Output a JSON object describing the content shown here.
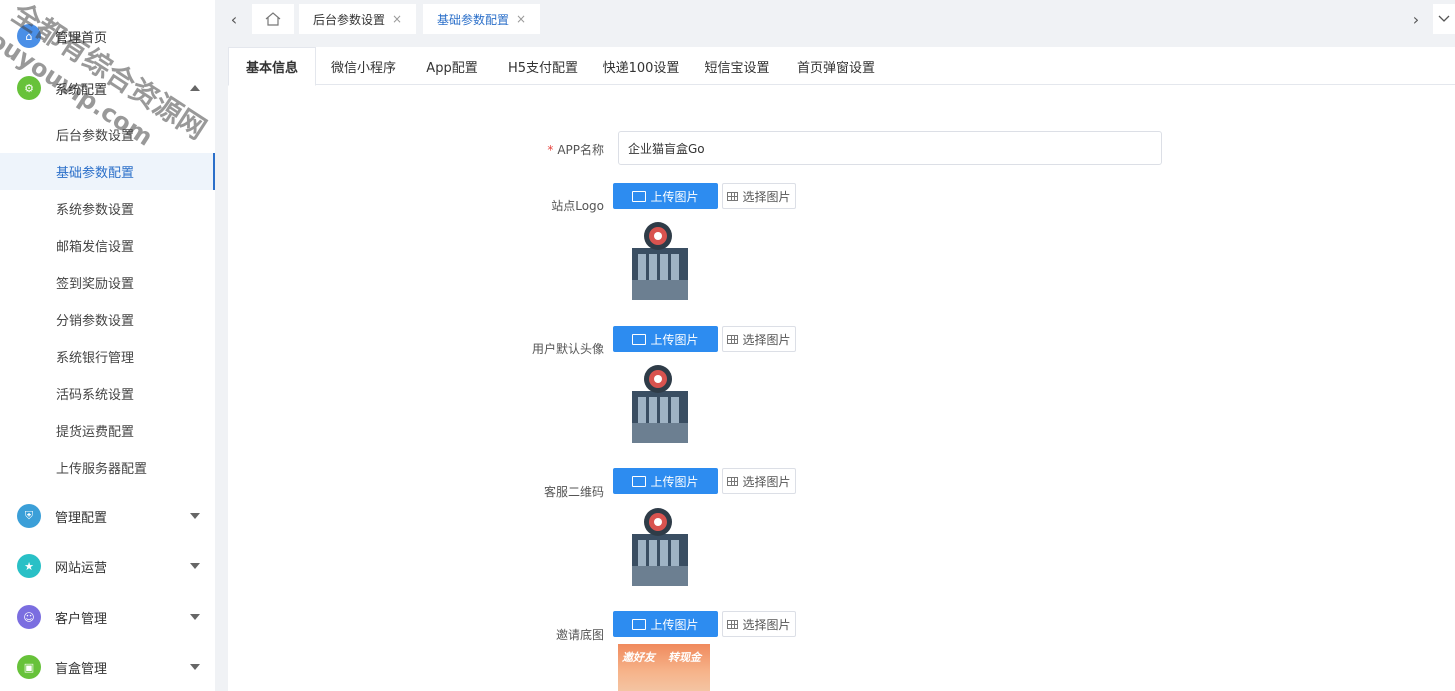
{
  "sidebar": {
    "groups": [
      {
        "label": "管理首页",
        "icon": "home-icon",
        "color": "#4a8fe7"
      },
      {
        "label": "系统配置",
        "icon": "gear-icon",
        "color": "#67c23a"
      },
      {
        "label": "管理配置",
        "icon": "shield-icon",
        "color": "#3b9fd8"
      },
      {
        "label": "网站运营",
        "icon": "star-icon",
        "color": "#29c0c6"
      },
      {
        "label": "客户管理",
        "icon": "user-icon",
        "color": "#7b6ee0"
      },
      {
        "label": "盲盒管理",
        "icon": "gift-icon",
        "color": "#67c23a"
      }
    ],
    "sub_items": [
      "后台参数设置",
      "基础参数配置",
      "系统参数设置",
      "邮箱发信设置",
      "签到奖励设置",
      "分销参数设置",
      "系统银行管理",
      "活码系统设置",
      "提货运费配置",
      "上传服务器配置"
    ]
  },
  "watermark": {
    "line1": "全都有综合资源网",
    "line2": "douyouvip.com"
  },
  "tabsbar": {
    "tabs": [
      "后台参数设置",
      "基础参数配置"
    ],
    "close": "×"
  },
  "content_tabs": [
    "基本信息",
    "微信小程序",
    "App配置",
    "H5支付配置",
    "快递100设置",
    "短信宝设置",
    "首页弹窗设置"
  ],
  "form": {
    "app_name_label": "APP名称",
    "required_mark": "*",
    "app_name_value": "企业猫盲盒Go",
    "upload_label": "上传图片",
    "select_label": "选择图片",
    "fields": [
      "站点Logo",
      "用户默认头像",
      "客服二维码",
      "邀请底图"
    ],
    "invite_text_left": "邀好友",
    "invite_text_right": "转现金"
  },
  "colors": {
    "primary": "#2d8cf0",
    "active_text": "#2b6fc9",
    "required": "#e6443e"
  }
}
